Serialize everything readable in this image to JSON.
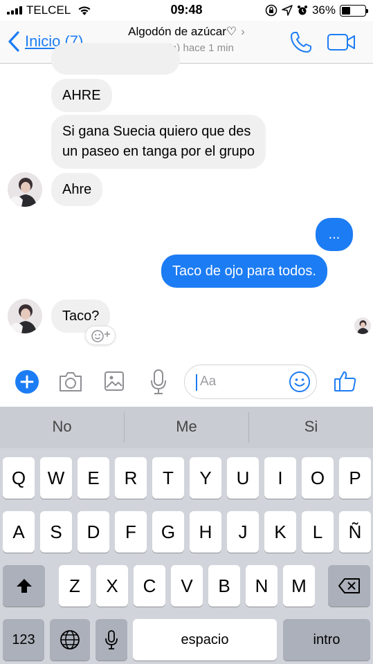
{
  "status_bar": {
    "carrier": "TELCEL",
    "time": "09:48",
    "battery": "36%",
    "battery_level": 0.36
  },
  "nav": {
    "back_label": "Inicio (7)",
    "title": "Algodón de azúcar♡",
    "title_chevron": "›",
    "subtitle": "Activo(a) hace 1 min"
  },
  "messages": [
    {
      "side": "in",
      "text": "AHRE"
    },
    {
      "side": "in",
      "text_line1": "Si gana Suecia quiero que des",
      "text_line2": "un paseo en tanga por el grupo"
    },
    {
      "side": "in",
      "text": "Ahre"
    },
    {
      "side": "out",
      "text": "..."
    },
    {
      "side": "out",
      "text": "Taco de ojo para todos."
    },
    {
      "side": "in",
      "text": "Taco?"
    }
  ],
  "composer": {
    "placeholder": "Aa"
  },
  "keyboard": {
    "suggestions": [
      "No",
      "Me",
      "Si"
    ],
    "row1": [
      "Q",
      "W",
      "E",
      "R",
      "T",
      "Y",
      "U",
      "I",
      "O",
      "P"
    ],
    "row2": [
      "A",
      "S",
      "D",
      "F",
      "G",
      "H",
      "J",
      "K",
      "L",
      "Ñ"
    ],
    "row3": [
      "Z",
      "X",
      "C",
      "V",
      "B",
      "N",
      "M"
    ],
    "numbers_key": "123",
    "space_key": "espacio",
    "return_key": "intro"
  },
  "colors": {
    "accent": "#1c7cf4",
    "incoming_bubble": "#f1f0f0",
    "keyboard_bg": "#d1d4da"
  }
}
